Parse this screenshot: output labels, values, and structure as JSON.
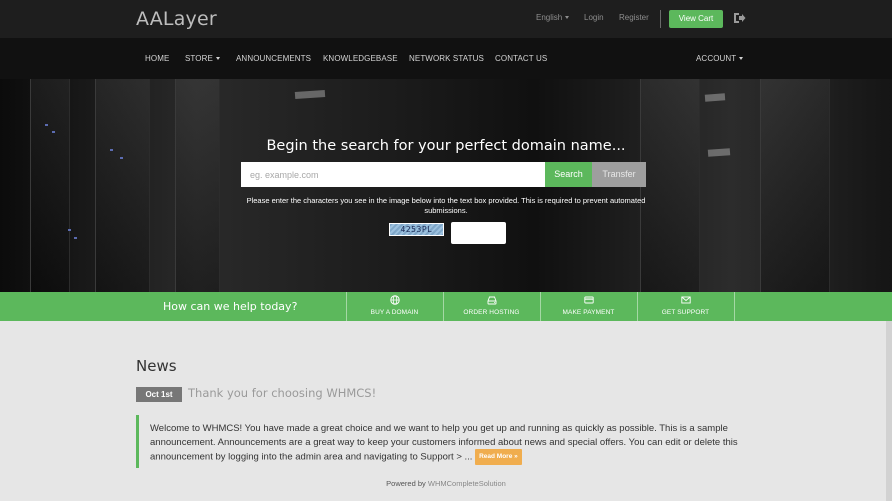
{
  "header": {
    "logo": "AALayer",
    "language": "English",
    "login": "Login",
    "register": "Register",
    "view_cart": "View Cart",
    "logout_icon": "logout-icon"
  },
  "nav": {
    "items": [
      "HOME",
      "STORE",
      "ANNOUNCEMENTS",
      "KNOWLEDGEBASE",
      "NETWORK STATUS",
      "CONTACT US"
    ],
    "account": "ACCOUNT"
  },
  "hero": {
    "title": "Begin the search for your perfect domain name...",
    "search_placeholder": "eg. example.com",
    "search_label": "Search",
    "transfer_label": "Transfer",
    "captcha_note": "Please enter the characters you see in the image below into the text box provided. This is required to prevent automated submissions.",
    "captcha_code": "4253PL"
  },
  "help": {
    "title": "How can we help today?",
    "items": [
      {
        "label": "BUY A DOMAIN",
        "icon": "globe-icon"
      },
      {
        "label": "ORDER HOSTING",
        "icon": "server-icon"
      },
      {
        "label": "MAKE PAYMENT",
        "icon": "credit-card-icon"
      },
      {
        "label": "GET SUPPORT",
        "icon": "envelope-icon"
      }
    ]
  },
  "news": {
    "title": "News",
    "date": "Oct 1st",
    "headline": "Thank you for choosing WHMCS!",
    "body": "Welcome to WHMCS! You have made a great choice and we want to help you get up and running as quickly as possible. This is a sample announcement. Announcements are a great way to keep your customers informed about news and special offers. You can edit or delete this announcement by logging into the admin area and navigating to Support > ...",
    "read_more": "Read More »"
  },
  "footer": {
    "powered_by": "Powered by",
    "brand": "WHMCompleteSolution"
  },
  "colors": {
    "accent": "#5cb85c",
    "read_more": "#f0ad4e",
    "topbar": "#1e1e1e",
    "navbar": "#111111"
  }
}
